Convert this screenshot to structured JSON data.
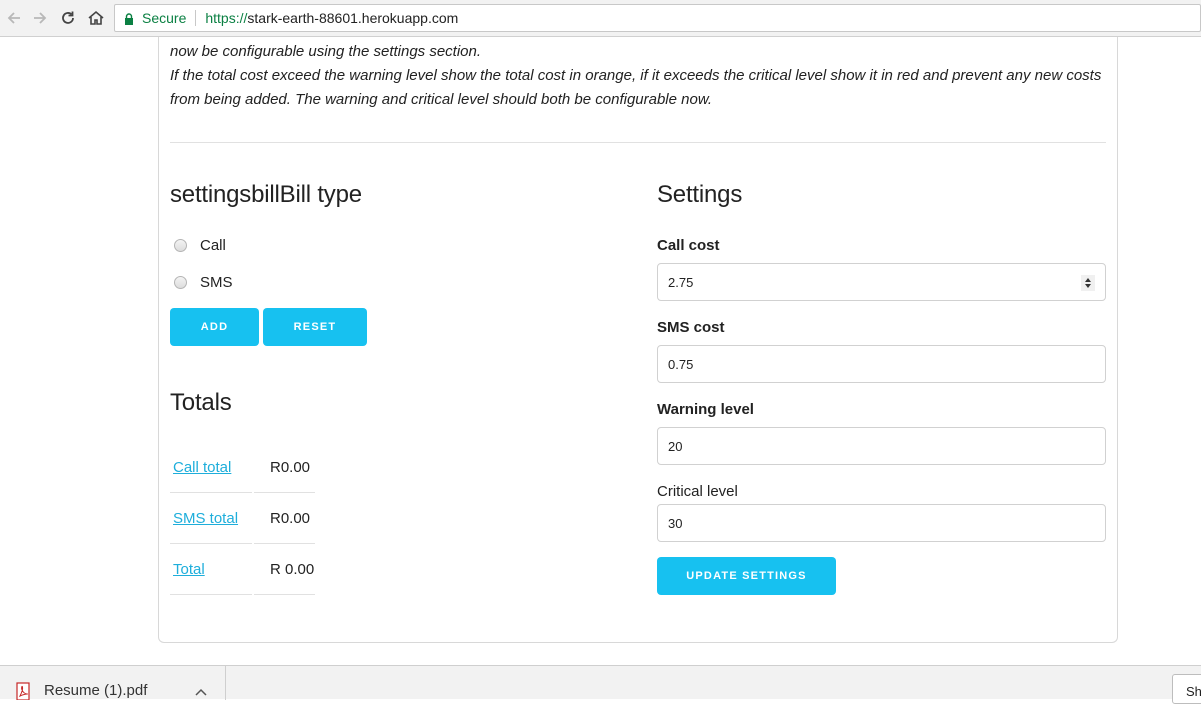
{
  "browser": {
    "secure_label": "Secure",
    "url_scheme": "https://",
    "url_host": "stark-earth-88601.herokuapp.com"
  },
  "intro": {
    "line1": "now be configurable using the settings section.",
    "line2": "If the total cost exceed the warning level show the total cost in orange, if it exceeds the critical level show it in red and prevent any new costs from being added. The warning and critical level should both be configurable now."
  },
  "bill": {
    "heading": "settingsbillBill type",
    "options": [
      {
        "label": "Call",
        "checked": false
      },
      {
        "label": "SMS",
        "checked": false
      }
    ],
    "add_label": "ADD",
    "reset_label": "RESET"
  },
  "totals": {
    "heading": "Totals",
    "rows": [
      {
        "label": "Call total",
        "value": "R0.00"
      },
      {
        "label": "SMS total",
        "value": "R0.00"
      },
      {
        "label": "Total",
        "value": "R 0.00"
      }
    ]
  },
  "settings": {
    "heading": "Settings",
    "call_cost_label": "Call cost",
    "call_cost_value": "2.75",
    "sms_cost_label": "SMS cost",
    "sms_cost_value": "0.75",
    "warning_label": "Warning level",
    "warning_value": "20",
    "critical_label": "Critical level",
    "critical_value": "30",
    "update_label": "UPDATE SETTINGS"
  },
  "downloads": {
    "file_name": "Resume (1).pdf",
    "show_all_label": "Sh"
  },
  "colors": {
    "accent": "#17c1f0",
    "link": "#1eaedb",
    "secure_green": "#0b8043"
  }
}
